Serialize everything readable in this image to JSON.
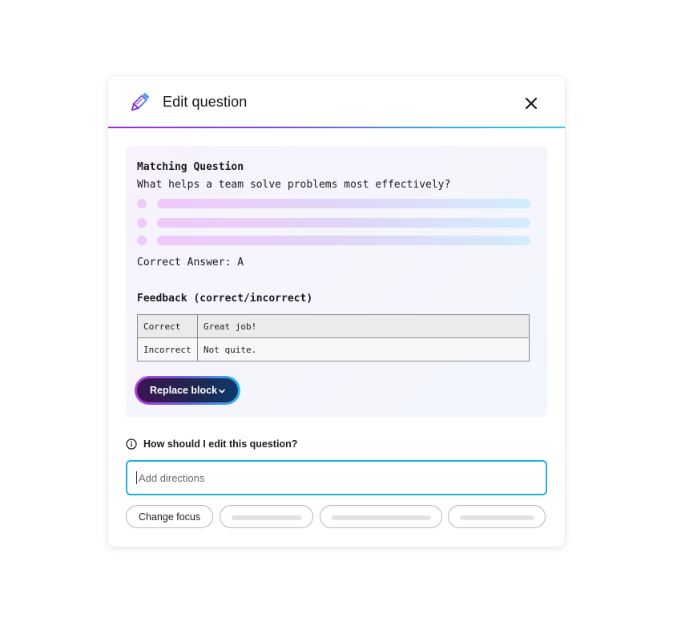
{
  "dialog": {
    "title": "Edit question",
    "icons": {
      "title": "pencil-icon",
      "close": "close-icon"
    },
    "colors": {
      "divider_start": "#9b2bd6",
      "divider_end": "#2ec5f0",
      "input_border": "#1db3dd",
      "button_bg_start": "#3b1452",
      "button_bg_end": "#0d3a6c"
    }
  },
  "preview": {
    "question_type": "Matching Question",
    "question_text": "What helps a team solve problems most effectively?",
    "correct_answer": "Correct Answer: A",
    "feedback_heading": "Feedback (correct/incorrect)",
    "feedback": [
      {
        "label": "Correct",
        "text": "Great job!"
      },
      {
        "label": "Incorrect",
        "text": "Not quite."
      }
    ],
    "replace_button": "Replace block"
  },
  "edit": {
    "prompt_label": "How should I edit this question?",
    "input_placeholder": "Add directions",
    "input_value": "",
    "chips": [
      "Change focus"
    ]
  }
}
